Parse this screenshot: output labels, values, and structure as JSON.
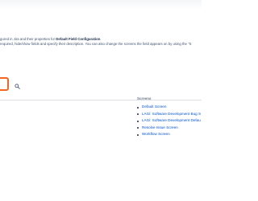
{
  "description": {
    "line1_prefix": "gured in Jira and their properties for ",
    "line1_bold": "Default Field Configuration",
    "line1_suffix": ".",
    "line2": "required, hide/show fields and specify their description. You can also change the screens the field appears on by using the \"S"
  },
  "search": {
    "icon": "search-icon"
  },
  "table": {
    "screens_header": "Screens",
    "screens": [
      "Default Screen",
      "LAGi: Software Development Bug S",
      "LAGi: Software Development Defau",
      "Resolve Issue Screen",
      "Workflow Screen"
    ]
  },
  "colors": {
    "highlight": "#f26522",
    "link": "#0052cc"
  }
}
